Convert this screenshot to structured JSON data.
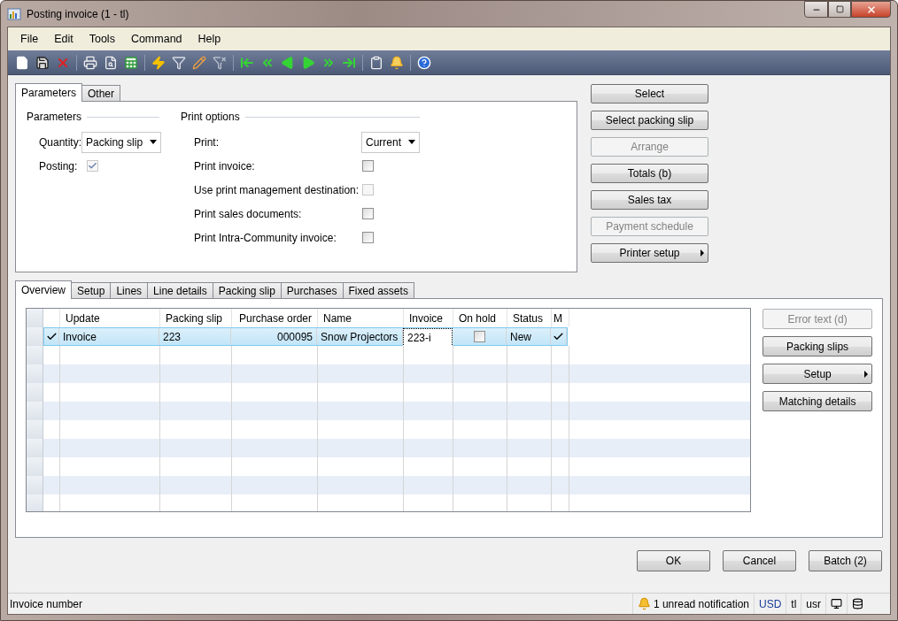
{
  "window": {
    "title": "Posting invoice (1 - tl)"
  },
  "menu": [
    "File",
    "Edit",
    "Tools",
    "Command",
    "Help"
  ],
  "top_tabs": [
    {
      "label": "Parameters",
      "selected": true
    },
    {
      "label": "Other",
      "selected": false
    }
  ],
  "parameters": {
    "heading": "Parameters",
    "quantity": {
      "label": "Quantity:",
      "value": "Packing slip"
    },
    "posting": {
      "label": "Posting:",
      "checked": true,
      "disabled": true
    }
  },
  "print_options": {
    "heading": "Print options",
    "print": {
      "label": "Print:",
      "value": "Current"
    },
    "checkboxes": [
      {
        "label": "Print invoice:",
        "checked": false,
        "disabled": false
      },
      {
        "label": "Use print management destination:",
        "checked": false,
        "disabled": true
      },
      {
        "label": "Print sales documents:",
        "checked": false,
        "disabled": false
      },
      {
        "label": "Print Intra-Community invoice:",
        "checked": false,
        "disabled": false
      }
    ]
  },
  "side_buttons": [
    {
      "label": "Select",
      "disabled": false,
      "menu": false
    },
    {
      "label": "Select packing slip",
      "disabled": false,
      "menu": false
    },
    {
      "label": "Arrange",
      "disabled": true,
      "menu": false
    },
    {
      "label": "Totals (b)",
      "disabled": false,
      "menu": false
    },
    {
      "label": "Sales tax",
      "disabled": false,
      "menu": false
    },
    {
      "label": "Payment schedule",
      "disabled": true,
      "menu": false
    },
    {
      "label": "Printer setup",
      "disabled": false,
      "menu": true
    }
  ],
  "bottom_tabs": [
    {
      "label": "Overview",
      "selected": true
    },
    {
      "label": "Setup",
      "selected": false
    },
    {
      "label": "Lines",
      "selected": false
    },
    {
      "label": "Line details",
      "selected": false
    },
    {
      "label": "Packing slip",
      "selected": false
    },
    {
      "label": "Purchases",
      "selected": false
    },
    {
      "label": "Fixed assets",
      "selected": false
    }
  ],
  "grid": {
    "columns": [
      "Update",
      "Packing slip",
      "Purchase order",
      "Name",
      "Invoice",
      "On hold",
      "Status",
      "M"
    ],
    "rows": [
      {
        "selected": true,
        "marked": true,
        "update": "Invoice",
        "packing_slip": "223",
        "purchase_order": "000095",
        "name": "Snow Projectors",
        "invoice": "223-i",
        "on_hold": false,
        "status": "New",
        "column_9": true
      }
    ]
  },
  "grid_buttons": [
    {
      "label": "Error text (d)",
      "disabled": true,
      "menu": false
    },
    {
      "label": "Packing slips",
      "disabled": false,
      "menu": false
    },
    {
      "label": "Setup",
      "disabled": false,
      "menu": true
    },
    {
      "label": "Matching details",
      "disabled": false,
      "menu": false
    }
  ],
  "footer_buttons": [
    "OK",
    "Cancel",
    "Batch (2)"
  ],
  "status_bar": {
    "text": "Invoice number",
    "notification": "1 unread notification",
    "currency": "USD",
    "company": "tl",
    "layer": "usr"
  }
}
